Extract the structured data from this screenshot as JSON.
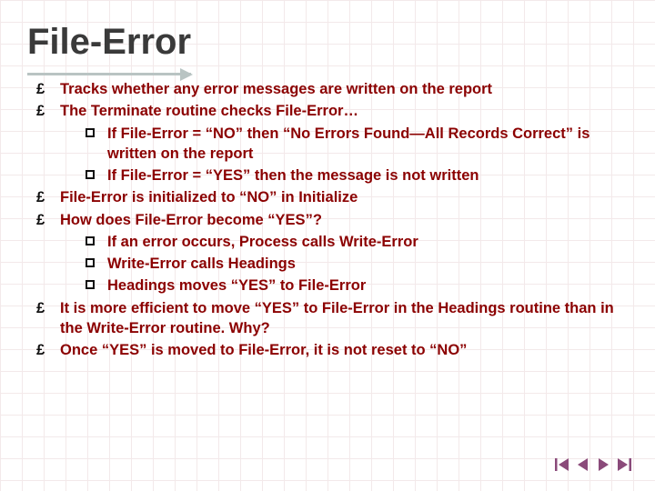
{
  "title": "File-Error",
  "bullets": [
    {
      "text": "Tracks whether any error messages are written on the report"
    },
    {
      "text": "The Terminate routine checks File-Error…",
      "children": [
        {
          "text": "If File-Error = “NO” then “No Errors Found—All Records Correct” is written on the report"
        },
        {
          "text": "If File-Error = “YES” then the message is not written"
        }
      ]
    },
    {
      "text": "File-Error is initialized to “NO” in Initialize"
    },
    {
      "text": "How does File-Error become “YES”?",
      "children": [
        {
          "text": "If an error occurs, Process calls Write-Error"
        },
        {
          "text": "Write-Error calls Headings"
        },
        {
          "text": "Headings moves “YES” to File-Error"
        }
      ]
    },
    {
      "text": "It is more efficient to move “YES” to File-Error in the Headings routine than in the Write-Error routine.  Why?"
    },
    {
      "text": "Once “YES” is moved to File-Error, it is not reset to “NO”"
    }
  ],
  "nav": {
    "first": "first-slide",
    "prev": "previous-slide",
    "next": "next-slide",
    "last": "last-slide"
  },
  "colors": {
    "text": "#8b0000",
    "rule": "#b9c4c3",
    "nav": "#8a4a7a"
  }
}
